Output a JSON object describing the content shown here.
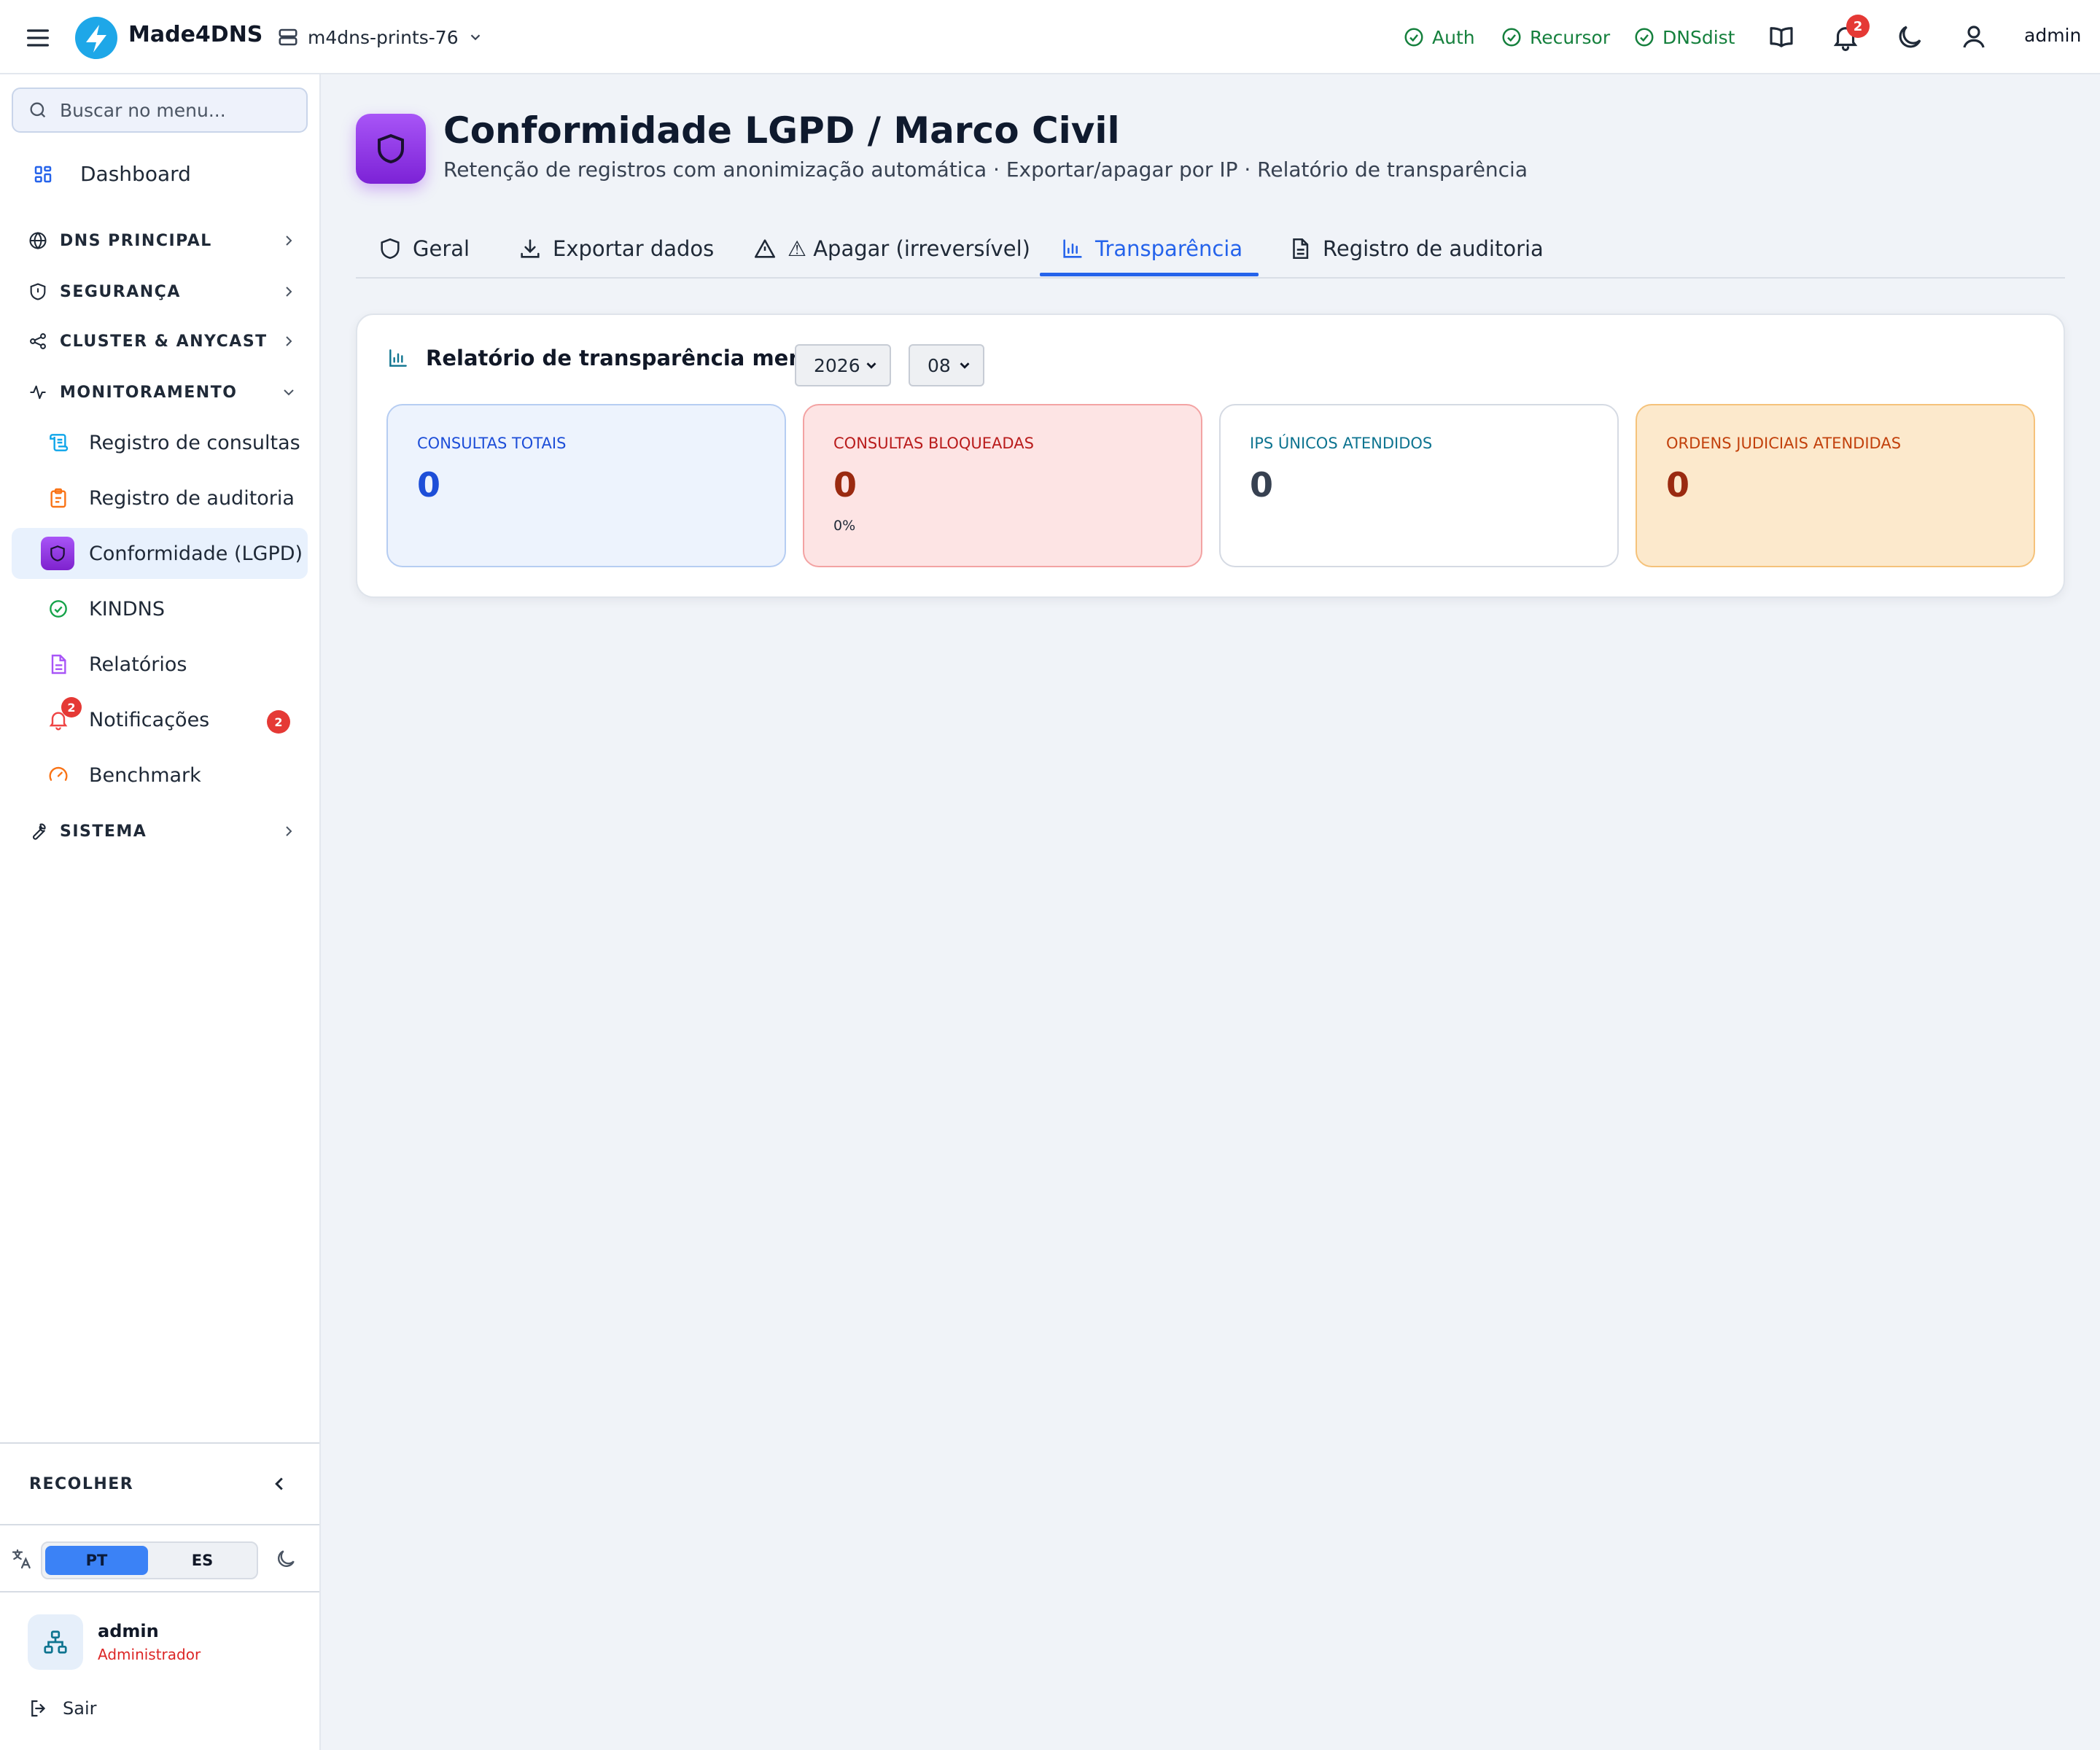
{
  "colors": {
    "accent": "#2563eb",
    "status_ok": "#15803d",
    "brand_purple": "#9333ea",
    "badge_red": "#e53935"
  },
  "topbar": {
    "brand": "Made4DNS",
    "server": "m4dns-prints-76",
    "services": [
      {
        "label": "Auth",
        "icon": "check-circle-icon"
      },
      {
        "label": "Recursor",
        "icon": "check-circle-icon"
      },
      {
        "label": "DNSdist",
        "icon": "check-circle-icon"
      }
    ],
    "notification_count": "2",
    "user": "admin"
  },
  "sidebar": {
    "search_placeholder": "Buscar no menu...",
    "dashboard": "Dashboard",
    "sections": {
      "dns": "DNS PRINCIPAL",
      "security": "SEGURANÇA",
      "cluster": "CLUSTER & ANYCAST",
      "monitoring": "MONITORAMENTO",
      "system": "SISTEMA"
    },
    "monitoring_items": [
      {
        "label": "Registro de consultas",
        "icon": "scroll-icon"
      },
      {
        "label": "Registro de auditoria",
        "icon": "clipboard-icon"
      },
      {
        "label": "Conformidade (LGPD)",
        "icon": "shield-icon",
        "active": true
      },
      {
        "label": "KINDNS",
        "icon": "check-circle-icon"
      },
      {
        "label": "Relatórios",
        "icon": "file-text-icon"
      },
      {
        "label": "Notificações",
        "icon": "bell-icon",
        "badge": "2"
      },
      {
        "label": "Benchmark",
        "icon": "gauge-icon"
      }
    ],
    "collapse_label": "RECOLHER",
    "languages": [
      "PT",
      "ES"
    ],
    "selected_language": "PT",
    "user": {
      "name": "admin",
      "role": "Administrador"
    },
    "logout": "Sair"
  },
  "page": {
    "title": "Conformidade LGPD / Marco Civil",
    "subtitle": "Retenção de registros com anonimização automática · Exportar/apagar por IP · Relatório de transparência",
    "tabs": [
      {
        "label": "Geral",
        "icon": "shield-icon"
      },
      {
        "label": "Exportar dados",
        "icon": "download-icon"
      },
      {
        "label": "⚠ Apagar (irreversível)",
        "icon": "alert-triangle-icon"
      },
      {
        "label": "Transparência",
        "icon": "bar-chart-icon",
        "active": true
      },
      {
        "label": "Registro de auditoria",
        "icon": "file-text-icon"
      }
    ]
  },
  "report": {
    "title": "Relatório de transparência mensal",
    "year": "2026",
    "month": "08",
    "stats": [
      {
        "label": "CONSULTAS TOTAIS",
        "value": "0"
      },
      {
        "label": "CONSULTAS BLOQUEADAS",
        "value": "0",
        "sub": "0%"
      },
      {
        "label": "IPS ÚNICOS ATENDIDOS",
        "value": "0"
      },
      {
        "label": "ORDENS JUDICIAIS ATENDIDAS",
        "value": "0"
      }
    ]
  }
}
